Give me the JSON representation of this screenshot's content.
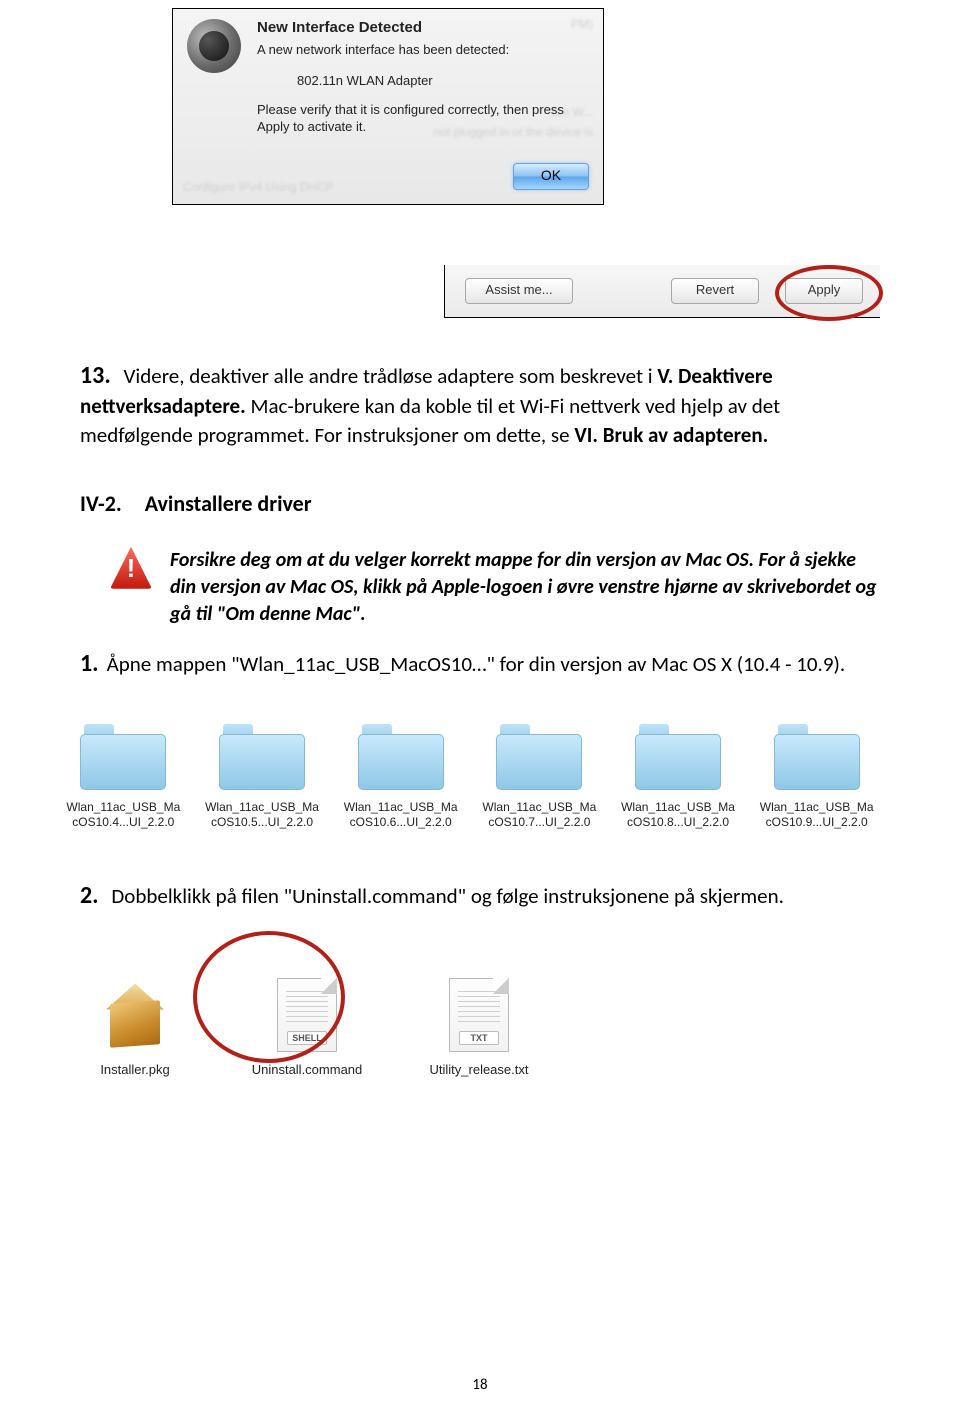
{
  "dialog": {
    "title": "New Interface Detected",
    "line1": "A new network interface has been detected:",
    "device": "802.11n WLAN Adapter",
    "line2": "Please verify that it is configured correctly, then press Apply to activate it.",
    "ok": "OK"
  },
  "applybar": {
    "assist": "Assist me...",
    "revert": "Revert",
    "apply": "Apply"
  },
  "step13": {
    "num": "13.",
    "text_a": "Videre, deaktiver alle andre trådløse adaptere som beskrevet i ",
    "bold_a": "V. Deaktivere nettverksadaptere.",
    "text_b": " Mac-brukere kan da koble til et Wi-Fi nettverk ved hjelp av det medfølgende programmet. For instruksjoner om dette, se ",
    "bold_b": "VI. Bruk av adapteren."
  },
  "section": {
    "num": "IV-2.",
    "title": "Avinstallere driver"
  },
  "warning": "Forsikre deg om at du velger korrekt mappe for din versjon av Mac OS. For å sjekke din versjon av Mac OS, klikk på Apple-logoen i øvre venstre hjørne av skrivebordet og gå til \"Om denne Mac\".",
  "step1": {
    "num": "1.",
    "text": "Åpne mappen \"Wlan_11ac_USB_MacOS10…\" for din versjon av Mac OS X (10.4 - 10.9)."
  },
  "folders": [
    "Wlan_11ac_USB_Ma\ncOS10.4...UI_2.2.0",
    "Wlan_11ac_USB_Ma\ncOS10.5...UI_2.2.0",
    "Wlan_11ac_USB_Ma\ncOS10.6...UI_2.2.0",
    "Wlan_11ac_USB_Ma\ncOS10.7...UI_2.2.0",
    "Wlan_11ac_USB_Ma\ncOS10.8...UI_2.2.0",
    "Wlan_11ac_USB_Ma\ncOS10.9...UI_2.2.0"
  ],
  "step2": {
    "num": "2.",
    "text": "Dobbelklikk på filen \"Uninstall.command\" og følge instruksjonene på skjermen."
  },
  "files": {
    "installer": "Installer.pkg",
    "uninstall": "Uninstall.command",
    "shell_tag": "SHELL",
    "utility": "Utility_release.txt",
    "txt_tag": "TXT"
  },
  "pagenum": "18"
}
